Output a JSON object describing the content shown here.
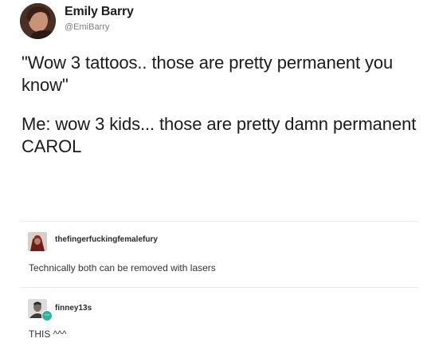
{
  "tweet": {
    "display_name": "Emily Barry",
    "handle": "@EmiBarry",
    "paragraph_1": "\"Wow 3 tattoos.. those are pretty permanent you know\"",
    "paragraph_2": "Me: wow 3 kids... those are pretty damn permanent CAROL"
  },
  "replies": [
    {
      "username": "thefingerfuckingfemalefury",
      "text": "Technically both can be removed with lasers",
      "avatar_icon": "user-avatar"
    },
    {
      "username": "finney13s",
      "text": "THIS ^^^",
      "avatar_icon": "user-avatar",
      "badge_icon": "chat-badge-icon",
      "badge_color": "#2fb3a0"
    }
  ]
}
